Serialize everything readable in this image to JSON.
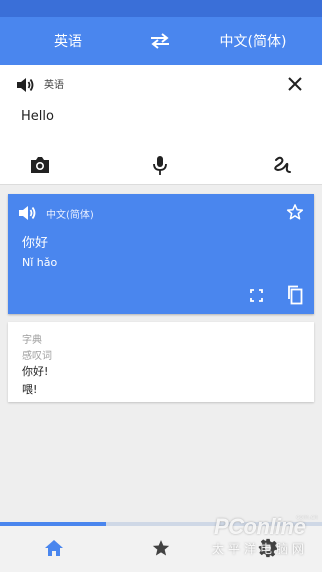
{
  "header": {
    "source_language": "英语",
    "target_language": "中文(简体)",
    "swap_icon": "swap-arrows-icon"
  },
  "input": {
    "language_label": "英语",
    "text": "Hello",
    "icons": [
      "speaker-icon",
      "clear-icon",
      "camera-icon",
      "microphone-icon",
      "handwriting-icon"
    ]
  },
  "result": {
    "language_label": "中文(简体)",
    "text": "你好",
    "transliteration": "Nǐ hǎo",
    "icons": [
      "speaker-icon",
      "star-outline-icon",
      "fullscreen-icon",
      "copy-icon"
    ]
  },
  "dictionary": {
    "title": "字典",
    "part_of_speech": "感叹词",
    "entries": [
      "你好!",
      "喂!"
    ]
  },
  "progress": {
    "fraction": 0.33
  },
  "bottom_nav": {
    "items": [
      "home-icon",
      "star-icon",
      "settings-icon"
    ],
    "active": "home-icon"
  },
  "watermark": {
    "brand": "PConline",
    "sub": "太平洋电脑网",
    "domain": "com.cn"
  },
  "colors": {
    "primary": "#4a86ee",
    "status_bar": "#3a6fd8",
    "background": "#eeeeee"
  }
}
